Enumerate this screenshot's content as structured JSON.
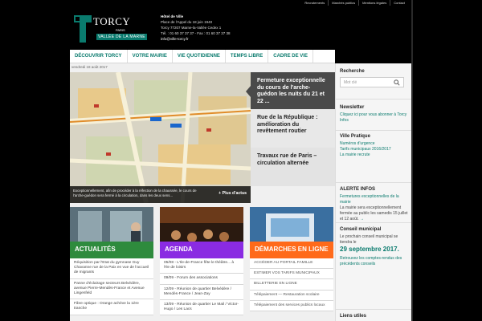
{
  "utility_links": [
    "Recrutements",
    "Marchés publics",
    "Mentions légales",
    "Contact"
  ],
  "logo": {
    "name": "TORCY",
    "paris": "PARIS",
    "vallee": "VALLÉE DE LA MARNE"
  },
  "address": {
    "line1": "Hôtel de Ville",
    "line2": "Place de l'Appel du 18 juin 1940",
    "line3": "Torcy 77207 Marne-la-Vallée Cedex 1",
    "line4": "Tél. : 01 60 37 37 37 - Fax : 01 60 37 37 38",
    "email": "info@ville-torcy.fr"
  },
  "nav": [
    "DÉCOUVRIR TORCY",
    "VOTRE MAIRIE",
    "VIE QUOTIDIENNE",
    "TEMPS LIBRE",
    "CADRE DE VIE"
  ],
  "date": "vendredi 18 août 2017",
  "slider": {
    "slides": [
      "Fermeture exceptionnelle du cours de l'arche-guédon les nuits du 21 et 22 ...",
      "Rue de la République : amélioration du revêtement routier",
      "Travaux rue de Paris – circulation alternée"
    ],
    "caption": "Exceptionnellement, afin de procéder à la réfection de la chaussée, le cours de l'arche-guédon sera fermé à la circulation, dans les deux sens...",
    "more": "+ Plus d'actus"
  },
  "sections": {
    "actualites": {
      "title": "ACTUALITÉS",
      "items": [
        "Réquisition par l'Etat du gymnase Guy Chavanne rue de la Paix en vue de l'accueil de migrants",
        "Panne d'éclairage secteurs Belvédère, avenue Pierre-Mendès-France et Avenue Lingenfeld",
        "Fibre optique : Orange achève la 1ère tranche"
      ]
    },
    "agenda": {
      "title": "AGENDA",
      "items": [
        "05/08 - L'Ile-de-France fête le théâtre... à l'Ile de loisirs",
        "09/09 - Forum des associations",
        "12/09 - Réunion de quartier Belvédère / Mendès-France / Jean-Zay",
        "13/09 - Réunion de quartier Le Mail / Victor-Hugo / Les Lacs"
      ]
    },
    "demarches": {
      "title": "DÉMARCHES EN LIGNE",
      "items": [
        "ACCÉDER AU PORTAIL FAMILLE",
        "ESTIMER VOS TARIFS MUNICIPAUX",
        "BILLETTERIE EN LIGNE",
        "Télépaiement — Restauration scolaire",
        "Télépaiement des services publics locaux"
      ]
    }
  },
  "sidebar": {
    "search_title": "Recherche",
    "search_placeholder": "Mot clé",
    "newsletter_title": "Newsletter",
    "newsletter_text": "Cliquez ici pour vous abonner à Torcy Infos",
    "pratique_title": "Ville Pratique",
    "pratique_links": [
      "Numéros d'urgence",
      "Tarifs municipaux 2016/2017",
      "La mairie recrute"
    ],
    "alerte_title": "ALERTE INFOS",
    "alerte_link": "Fermetures exceptionnelles de la mairie",
    "alerte_text": "La mairie sera exceptionnellement fermée au public les samedis 15 juillet et 12 août.",
    "alerte_arrow": "→",
    "conseil_title": "Conseil municipal",
    "conseil_text": "Le prochain conseil municipal se tiendra le",
    "conseil_date": "29 septembre 2017.",
    "conseil_link": "Retrouvez les comptes-rendus des précédents conseils",
    "liens_title": "Liens utiles"
  },
  "colors": {
    "accent": "#0a7b6e",
    "actualites": "#2e8b3d",
    "agenda": "#8a2be2",
    "demarches": "#ff6a1a"
  }
}
